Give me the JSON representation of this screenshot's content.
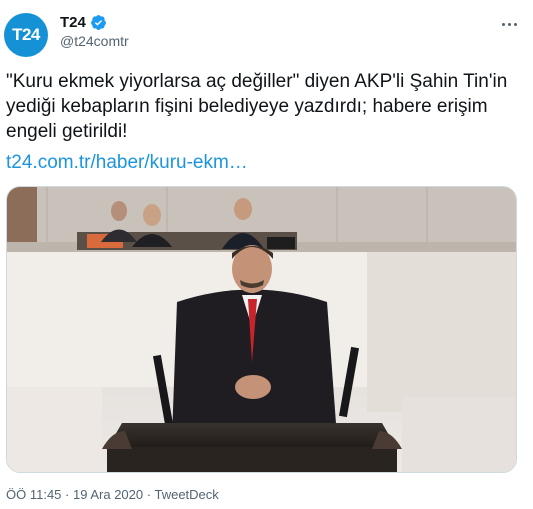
{
  "account": {
    "avatar_text": "T24",
    "display_name": "T24",
    "handle": "@t24comtr",
    "brand_color": "#1591d6",
    "verified_icon": "verified-badge-icon"
  },
  "tweet": {
    "text": "\"Kuru ekmek yiyorlarsa aç değiller\" diyen AKP'li Şahin Tin'in yediği kebapların fişini belediyeye yazdırdı; habere erişim engeli getirildi!",
    "link": "t24.com.tr/haber/kuru-ekm…",
    "link_color": "#1b95e0"
  },
  "meta": {
    "time": "ÖÖ 11:45",
    "date": "19 Ara 2020",
    "source": "TweetDeck",
    "separator": "·"
  }
}
